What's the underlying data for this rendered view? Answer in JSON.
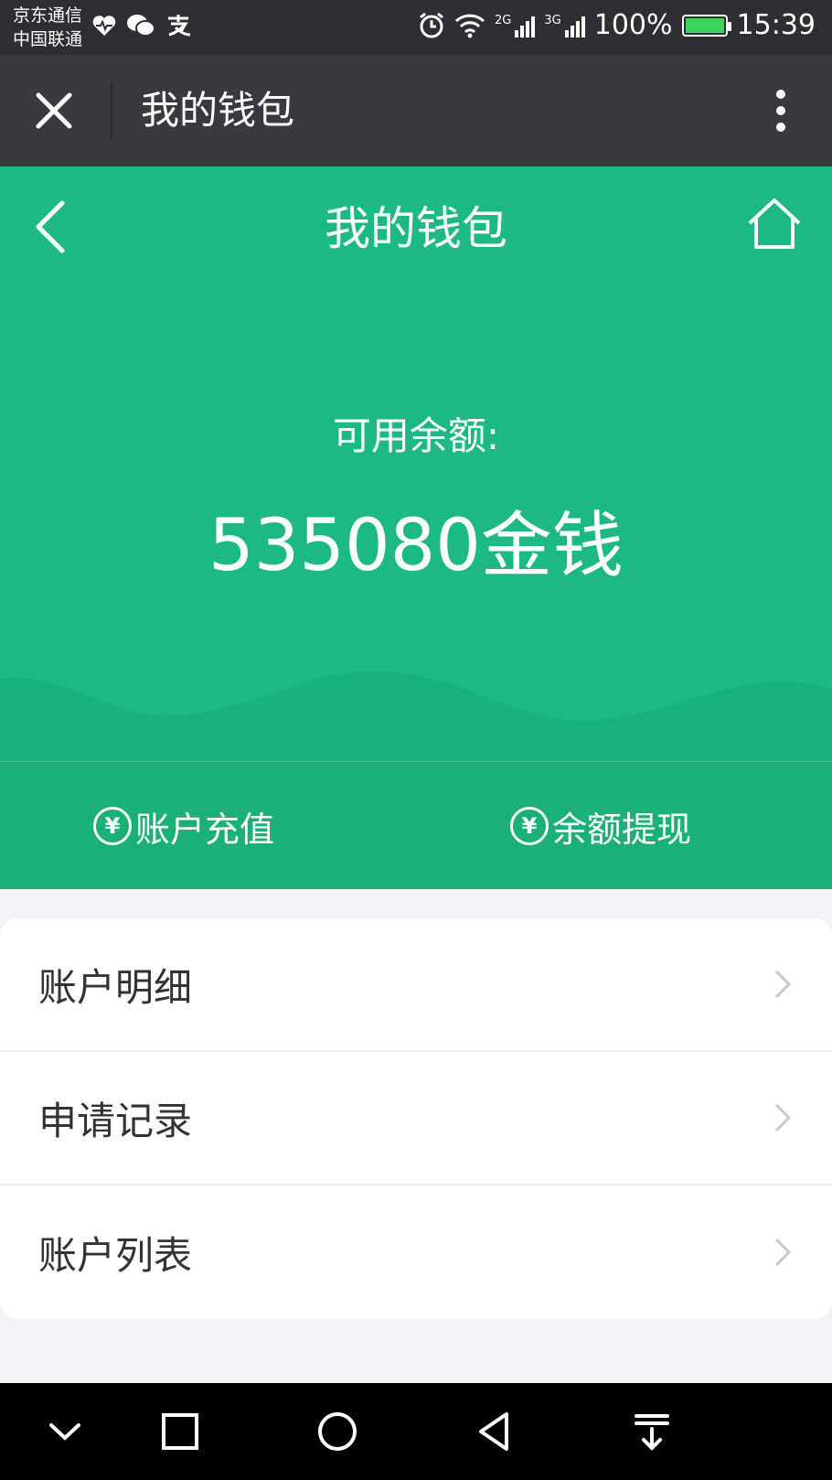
{
  "status_bar": {
    "carrier_line1": "京东通信",
    "carrier_line2": "中国联通",
    "signal1_tag": "2G",
    "signal2_tag": "3G",
    "battery": "100%",
    "time": "15:39"
  },
  "wechat_bar": {
    "title": "我的钱包",
    "close_icon": "close-icon",
    "more_icon": "more-vertical-icon"
  },
  "hero": {
    "title": "我的钱包",
    "back_icon": "chevron-left-icon",
    "home_icon": "home-icon",
    "balance_label": "可用余额:",
    "balance_value": "535080金钱",
    "accent_color": "#1cb983"
  },
  "actions": {
    "recharge_label": "账户充值",
    "withdraw_label": "余额提现",
    "icon_glyph": "¥"
  },
  "menu": {
    "items": [
      {
        "label": "账户明细"
      },
      {
        "label": "申请记录"
      },
      {
        "label": "账户列表"
      }
    ]
  }
}
